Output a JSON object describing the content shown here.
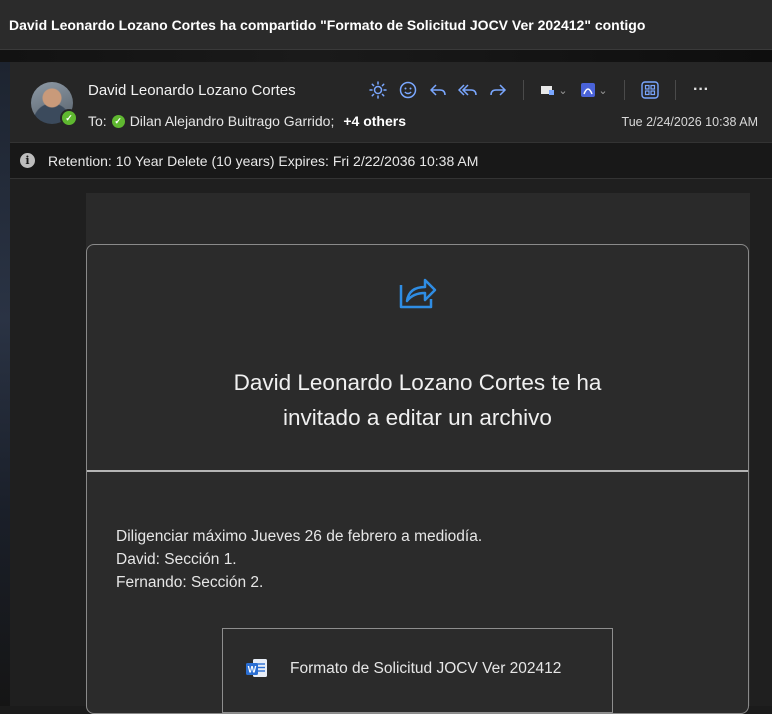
{
  "window": {
    "subject": "David Leonardo Lozano Cortes ha compartido \"Formato de Solicitud JOCV Ver 202412\" contigo"
  },
  "header": {
    "sender": "David Leonardo Lozano Cortes",
    "to_label": "To:",
    "recipient": "Dilan Alejandro Buitrago Garrido;",
    "others": "+4 others",
    "date": "Tue 2/24/2026 10:38 AM",
    "toolbar_icons": [
      "sun-icon",
      "emoji-icon",
      "reply-icon",
      "reply-all-icon",
      "forward-icon",
      "tag-icon",
      "pdf-icon",
      "apps-icon",
      "more-icon"
    ],
    "more_label": "···"
  },
  "retention": {
    "text": "Retention: 10 Year Delete (10 years) Expires: Fri 2/22/2036 10:38 AM"
  },
  "card": {
    "title_line1": "David Leonardo Lozano Cortes te ha",
    "title_line2": "invitado a editar un archivo",
    "message_lines": [
      "Diligenciar máximo Jueves 26 de febrero a mediodía.",
      "David: Sección 1.",
      "Fernando: Sección 2."
    ],
    "file_name": "Formato de Solicitud JOCV Ver 202412"
  },
  "colors": {
    "accent": "#7aa7ff",
    "share_icon": "#2f8de4",
    "presence": "#5fb830",
    "word_blue": "#2b6fd3"
  }
}
